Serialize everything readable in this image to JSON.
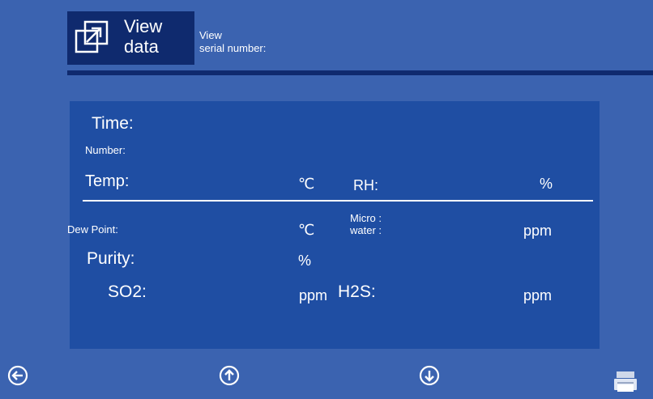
{
  "header": {
    "title": "View\ndata",
    "serial_label": "View\nserial number:"
  },
  "record": {
    "time_label": "Time:",
    "number_label": "Number:",
    "temp_label": "Temp:",
    "temp_unit": "℃",
    "rh_label": "RH:",
    "rh_unit": "%",
    "dew_point_label": "Dew Point:",
    "dew_point_unit": "℃",
    "micro_water_label": "Micro :\nwater :",
    "micro_water_unit": "ppm",
    "purity_label": "Purity:",
    "purity_unit": "%",
    "so2_label": "SO2:",
    "so2_unit": "ppm",
    "h2s_label": "H2S:",
    "h2s_unit": "ppm"
  },
  "icons": {
    "header": "open-external-icon",
    "back": "arrow-left-circle-icon",
    "previous": "arrow-up-circle-icon",
    "next": "arrow-down-circle-icon",
    "print": "printer-icon"
  },
  "colors": {
    "background": "#3b63b0",
    "panel": "#1f4ea3",
    "header_tile": "#0f2a6e",
    "text": "#ffffff"
  }
}
